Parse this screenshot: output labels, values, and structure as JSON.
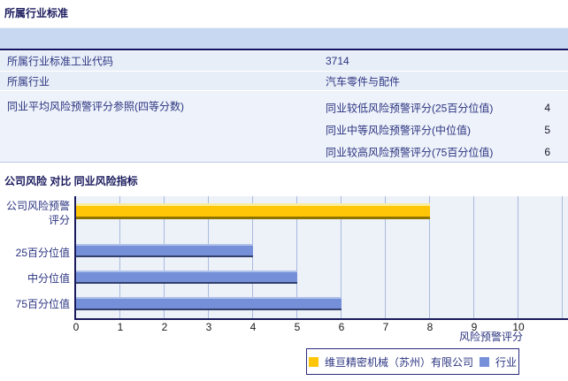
{
  "section1": {
    "title": "所属行业标准",
    "rows": [
      {
        "label": "所属行业标准工业代码",
        "value": "3714"
      },
      {
        "label": "所属行业",
        "value": "汽车零件与配件"
      },
      {
        "label": "同业平均风险预警评分参照(四等分数)",
        "subrows": [
          {
            "label": "同业较低风险预警评分(25百分位值)",
            "value": "4"
          },
          {
            "label": "同业中等风险预警评分(中位值)",
            "value": "5"
          },
          {
            "label": "同业较高风险预警评分(75百分位值)",
            "value": "6"
          }
        ]
      }
    ]
  },
  "section2": {
    "title": "公司风险 对比 同业风险指标"
  },
  "chart_data": {
    "type": "bar",
    "orientation": "horizontal",
    "title": "公司风险 对比 同业风险指标",
    "categories": [
      "公司风险预警评分",
      "25百分位值",
      "中分位值",
      "75百分位值"
    ],
    "series": [
      {
        "name": "维亘精密机械（苏州）有限公司",
        "color": "#FFC607",
        "values": [
          8,
          null,
          null,
          null
        ]
      },
      {
        "name": "行业",
        "color": "#7590D8",
        "values": [
          null,
          4,
          5,
          6
        ]
      }
    ],
    "xlabel": "风险预警评分",
    "xlim": [
      0,
      11
    ],
    "xticks": [
      0,
      1,
      2,
      3,
      4,
      5,
      6,
      7,
      8,
      9,
      10
    ],
    "grid": true,
    "legend_position": "bottom",
    "plot_bg": "#EDF1F8",
    "gridline_color": "#A9BBDF",
    "axis_color": "#1A1A5C"
  }
}
